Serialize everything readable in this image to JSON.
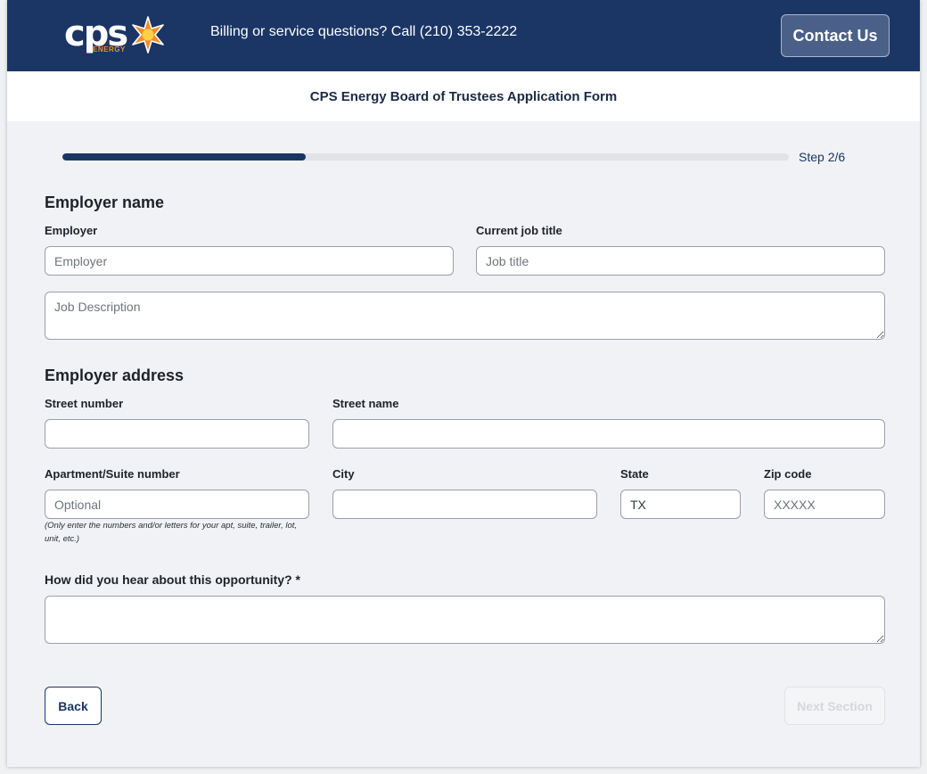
{
  "header": {
    "logo_text": "cps",
    "logo_sub": "ENERGY",
    "billing_text": "Billing or service questions? Call (210) 353-2222",
    "contact_label": "Contact Us"
  },
  "form_title": "CPS Energy Board of Trustees Application Form",
  "progress": {
    "fraction": 0.335,
    "step_label": "Step 2/6"
  },
  "employer_section": {
    "heading": "Employer name",
    "employer": {
      "label": "Employer",
      "placeholder": "Employer",
      "value": ""
    },
    "job_title": {
      "label": "Current job title",
      "placeholder": "Job title",
      "value": ""
    },
    "job_description": {
      "placeholder": "Job Description",
      "value": ""
    }
  },
  "address_section": {
    "heading": "Employer address",
    "street_number": {
      "label": "Street number",
      "placeholder": "",
      "value": ""
    },
    "street_name": {
      "label": "Street name",
      "placeholder": "",
      "value": ""
    },
    "apartment": {
      "label": "Apartment/Suite number",
      "placeholder": "Optional",
      "value": "",
      "hint": "(Only enter the numbers and/or letters for your apt, suite, trailer, lot, unit, etc.)"
    },
    "city": {
      "label": "City",
      "placeholder": "",
      "value": ""
    },
    "state": {
      "label": "State",
      "placeholder": "",
      "value": "TX"
    },
    "zip": {
      "label": "Zip code",
      "placeholder": "XXXXX",
      "value": ""
    }
  },
  "referral": {
    "label": "How did you hear about this opportunity? *",
    "value": ""
  },
  "nav": {
    "back_label": "Back",
    "next_label": "Next Section"
  },
  "colors": {
    "brand_navy": "#1b3664",
    "brand_orange": "#f28c28",
    "page_bg": "#f1f2f6"
  },
  "icons": {
    "logo_mark": "sun-star-icon"
  }
}
